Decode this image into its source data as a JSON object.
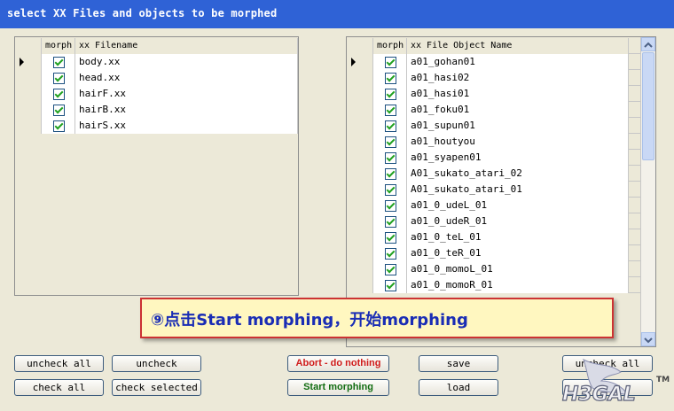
{
  "window": {
    "title": "select XX Files and objects to be morphed"
  },
  "left_grid": {
    "headers": {
      "morph": "morph",
      "name": "xx Filename"
    },
    "rows": [
      {
        "name": "body.xx",
        "checked": true,
        "current": true
      },
      {
        "name": "head.xx",
        "checked": true
      },
      {
        "name": "hairF.xx",
        "checked": true
      },
      {
        "name": "hairB.xx",
        "checked": true
      },
      {
        "name": "hairS.xx",
        "checked": true
      }
    ]
  },
  "right_grid": {
    "headers": {
      "morph": "morph",
      "name": "xx File Object Name"
    },
    "rows": [
      {
        "name": "a01_gohan01",
        "checked": true,
        "current": true
      },
      {
        "name": "a01_hasi02",
        "checked": true
      },
      {
        "name": "a01_hasi01",
        "checked": true
      },
      {
        "name": "a01_foku01",
        "checked": true
      },
      {
        "name": "a01_supun01",
        "checked": true
      },
      {
        "name": "a01_houtyou",
        "checked": true
      },
      {
        "name": "a01_syapen01",
        "checked": true
      },
      {
        "name": "A01_sukato_atari_02",
        "checked": true
      },
      {
        "name": "A01_sukato_atari_01",
        "checked": true
      },
      {
        "name": "a01_0_udeL_01",
        "checked": true
      },
      {
        "name": "a01_0_udeR_01",
        "checked": true
      },
      {
        "name": "a01_0_teL_01",
        "checked": true
      },
      {
        "name": "a01_0_teR_01",
        "checked": true
      },
      {
        "name": "a01_0_momoL_01",
        "checked": true
      },
      {
        "name": "a01_0_momoR_01",
        "checked": true
      }
    ]
  },
  "buttons": {
    "uncheck_all_files": "uncheck all",
    "check_all_files": "check all",
    "uncheck": "uncheck",
    "check_selected": "check selected",
    "abort": "Abort - do nothing",
    "start": "Start morphing",
    "save": "save",
    "load": "load",
    "uncheck_all_objects": "uncheck all"
  },
  "callout": {
    "text": "⑨点击Start morphing，开始morphing"
  },
  "watermark": {
    "text": "TM"
  },
  "colors": {
    "title_bar": "#2f62d6",
    "abort_text": "#d01b1b",
    "start_text": "#116c11",
    "callout_border": "#cc3333",
    "callout_text": "#1a2db5"
  }
}
